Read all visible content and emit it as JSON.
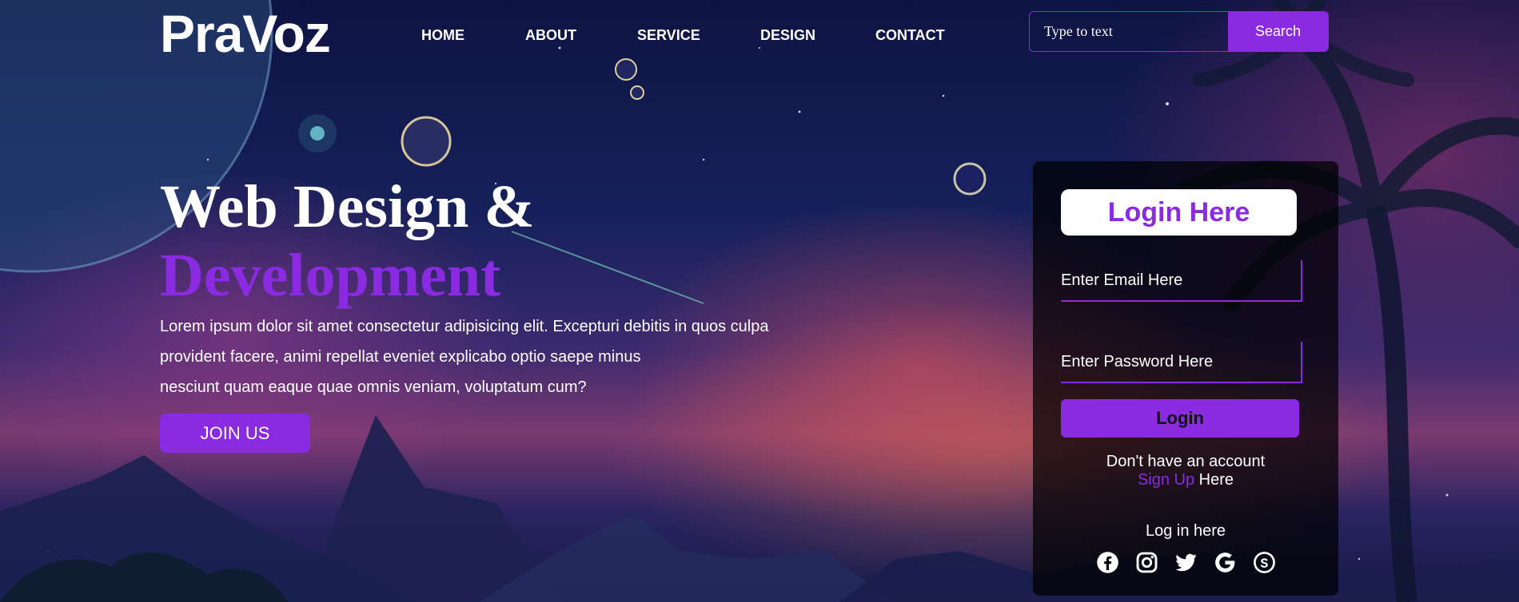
{
  "brand": {
    "logo": "PraVoz"
  },
  "nav": {
    "items": [
      {
        "label": "HOME"
      },
      {
        "label": "ABOUT"
      },
      {
        "label": "SERVICE"
      },
      {
        "label": "DESIGN"
      },
      {
        "label": "CONTACT"
      }
    ]
  },
  "search": {
    "placeholder": "Type to text",
    "button_label": "Search"
  },
  "hero": {
    "title_line1": "Web Design &",
    "title_line2": "Development",
    "text_line1": "Lorem ipsum dolor sit amet consectetur adipisicing elit. Excepturi debitis in quos culpa",
    "text_line2": "provident facere, animi repellat eveniet explicabo optio saepe minus",
    "text_line3": "nesciunt quam eaque quae omnis veniam, voluptatum cum?",
    "join_label": "JOIN US"
  },
  "login": {
    "title": "Login Here",
    "email_placeholder": "Enter Email Here",
    "password_placeholder": "Enter Password Here",
    "button_label": "Login",
    "no_account_text": "Don't have an account",
    "signup_link": "Sign Up",
    "signup_suffix": " Here",
    "login_here": "Log in here",
    "social_icons": [
      "facebook-icon",
      "instagram-icon",
      "twitter-icon",
      "google-icon",
      "skype-icon"
    ]
  },
  "colors": {
    "accent": "#8a2be2",
    "text": "#ffffff",
    "card": "#000000"
  }
}
